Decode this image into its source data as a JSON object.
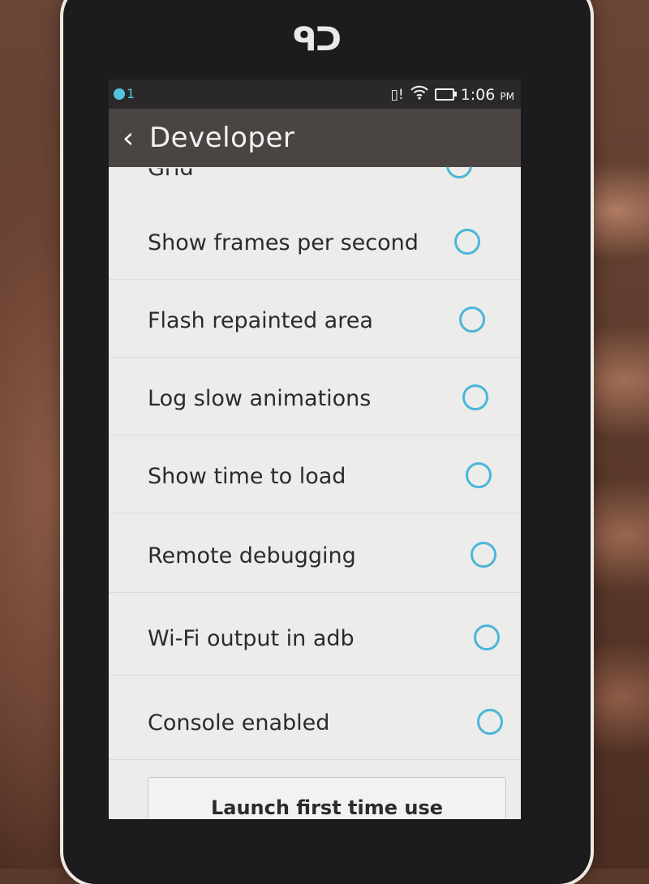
{
  "statusbar": {
    "notification_count": "1",
    "time": "1:06",
    "time_suffix": "PM"
  },
  "device_logo": "ᑫᑐ",
  "header": {
    "title": "Developer"
  },
  "partial_item": {
    "label": "Grid"
  },
  "settings": [
    {
      "label": "Show frames per second",
      "checked": false
    },
    {
      "label": "Flash repainted area",
      "checked": false
    },
    {
      "label": "Log slow animations",
      "checked": false
    },
    {
      "label": "Show time to load",
      "checked": false
    },
    {
      "label": "Remote debugging",
      "checked": false
    },
    {
      "label": "Wi-Fi output in adb",
      "checked": false
    },
    {
      "label": "Console enabled",
      "checked": false
    }
  ],
  "buttons": {
    "launch_ftu": "Launch first time use"
  },
  "colors": {
    "accent": "#4cb6d8",
    "header_bg": "#4a4443",
    "statusbar_bg": "#2a2829",
    "list_bg": "#ececea"
  },
  "icons": {
    "back": "chevron-left-icon",
    "signal": "sim-icon",
    "wifi": "wifi-icon",
    "battery": "battery-icon"
  }
}
